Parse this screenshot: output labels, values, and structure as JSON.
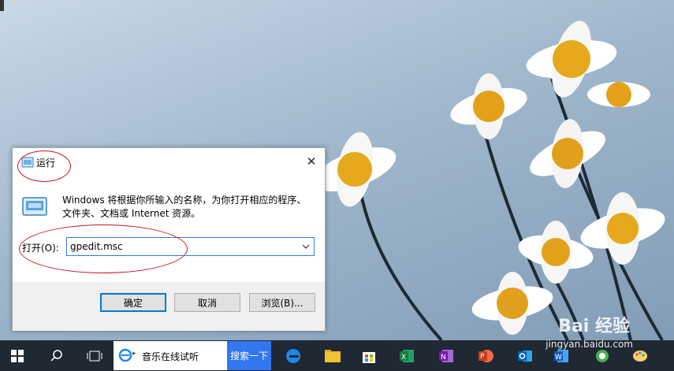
{
  "dialog": {
    "title": "运行",
    "description": "Windows 将根据你所输入的名称，为你打开相应的程序、文件夹、文档或 Internet 资源。",
    "open_label": "打开(O):",
    "open_value": "gpedit.msc",
    "ok_label": "确定",
    "cancel_label": "取消",
    "browse_label": "浏览(B)...",
    "close_glyph": "✕"
  },
  "taskbar": {
    "search_text": "音乐在线试听",
    "search_button": "搜索一下"
  },
  "watermark": {
    "brand": "Bai 经验",
    "url": "jingyan.baidu.com"
  },
  "colors": {
    "annotation": "#c8141c",
    "taskbar": "#1f2833",
    "accent": "#0078d7"
  }
}
